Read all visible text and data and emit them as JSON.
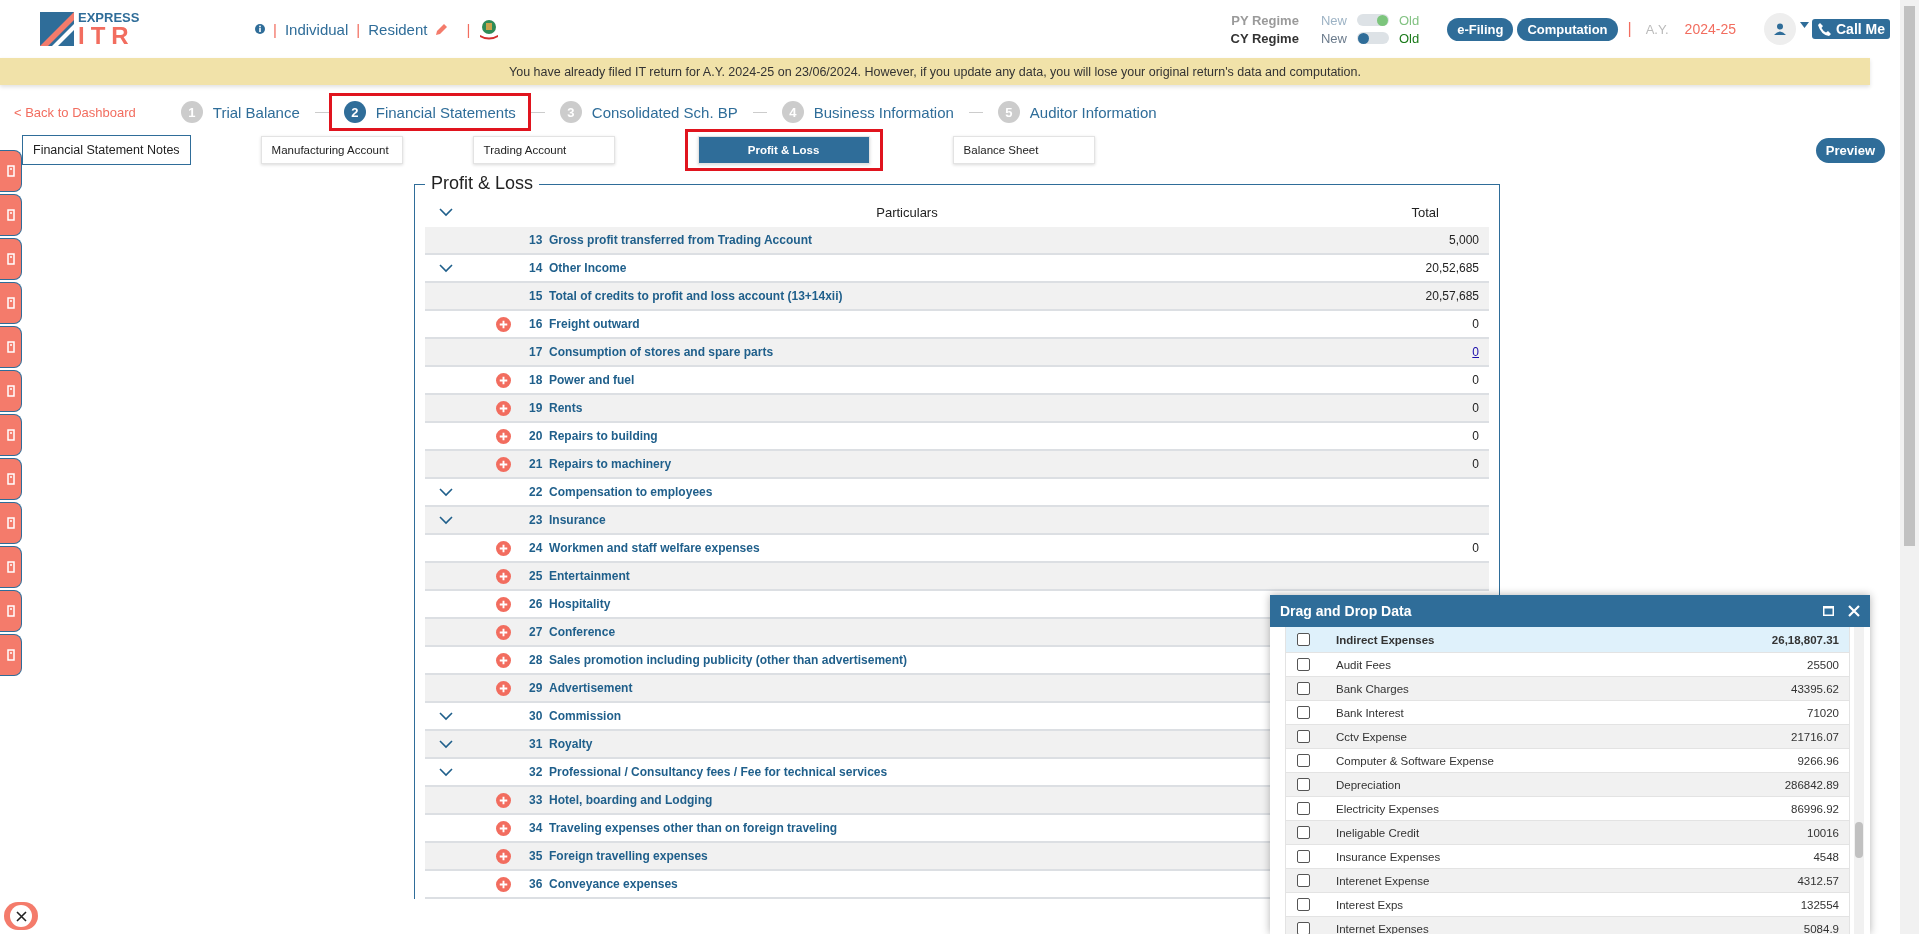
{
  "header": {
    "logo": {
      "top": "EXPRESS",
      "main": "ITR"
    },
    "separator": "|",
    "taxpayer_type": "Individual",
    "residency": "Resident",
    "regimes": [
      {
        "label": "PY Regime",
        "new": "New",
        "old": "Old",
        "old_selected": true,
        "disabled": true
      },
      {
        "label": "CY Regime",
        "new": "New",
        "old": "Old",
        "old_selected": false,
        "disabled": false
      }
    ],
    "buttons": [
      "e-Filing",
      "Computation"
    ],
    "ay_label": "A.Y.",
    "ay_value": "2024-25",
    "call_button": "Call Me"
  },
  "banner": "You have already filed IT return for A.Y. 2024-25 on 23/06/2024. However, if you update any data, you will lose your original return's data and computation.",
  "back_link": "< Back to Dashboard",
  "steps": [
    {
      "number": "1",
      "label": "Trial Balance",
      "selected": false
    },
    {
      "number": "2",
      "label": "Financial Statements",
      "selected": true
    },
    {
      "number": "3",
      "label": "Consolidated Sch. BP",
      "selected": false
    },
    {
      "number": "4",
      "label": "Business Information",
      "selected": false
    },
    {
      "number": "5",
      "label": "Auditor Information",
      "selected": false
    }
  ],
  "notes_button": "Financial Statement Notes",
  "subtabs": [
    {
      "label": "Manufacturing Account",
      "selected": false
    },
    {
      "label": "Trading Account",
      "selected": false
    },
    {
      "label": "Profit & Loss",
      "selected": true
    },
    {
      "label": "Balance Sheet",
      "selected": false
    }
  ],
  "preview_button": "Preview",
  "table": {
    "title": "Profit & Loss",
    "columns": [
      "Particulars",
      "Total"
    ],
    "rows": [
      {
        "kind": "fixed",
        "number": "13",
        "label": "Gross profit transferred from Trading Account",
        "total": "5,000",
        "linked": false
      },
      {
        "kind": "group",
        "number": "14",
        "label": "Other Income",
        "total": "20,52,685",
        "linked": false
      },
      {
        "kind": "fixed",
        "number": "15",
        "label": "Total of credits to profit and loss account (13+14xii)",
        "total": "20,57,685",
        "linked": false
      },
      {
        "kind": "item",
        "number": "16",
        "label": "Freight outward",
        "total": "0",
        "linked": false
      },
      {
        "kind": "fixed",
        "number": "17",
        "label": "Consumption of stores and spare parts",
        "total": "0",
        "linked": true
      },
      {
        "kind": "item",
        "number": "18",
        "label": "Power and fuel",
        "total": "0",
        "linked": false
      },
      {
        "kind": "item",
        "number": "19",
        "label": "Rents",
        "total": "0",
        "linked": false
      },
      {
        "kind": "item",
        "number": "20",
        "label": "Repairs to building",
        "total": "0",
        "linked": false
      },
      {
        "kind": "item",
        "number": "21",
        "label": "Repairs to machinery",
        "total": "0",
        "linked": false
      },
      {
        "kind": "group",
        "number": "22",
        "label": "Compensation to employees"
      },
      {
        "kind": "group",
        "number": "23",
        "label": "Insurance"
      },
      {
        "kind": "item",
        "number": "24",
        "label": "Workmen and staff welfare expenses",
        "total": "0",
        "linked": false
      },
      {
        "kind": "item",
        "number": "25",
        "label": "Entertainment"
      },
      {
        "kind": "item",
        "number": "26",
        "label": "Hospitality"
      },
      {
        "kind": "item",
        "number": "27",
        "label": "Conference"
      },
      {
        "kind": "item",
        "number": "28",
        "label": "Sales promotion including publicity (other than advertisement)"
      },
      {
        "kind": "item",
        "number": "29",
        "label": "Advertisement"
      },
      {
        "kind": "group",
        "number": "30",
        "label": "Commission"
      },
      {
        "kind": "group",
        "number": "31",
        "label": "Royalty"
      },
      {
        "kind": "group",
        "number": "32",
        "label": "Professional / Consultancy fees / Fee for technical services"
      },
      {
        "kind": "item",
        "number": "33",
        "label": "Hotel, boarding and Lodging"
      },
      {
        "kind": "item",
        "number": "34",
        "label": "Traveling expenses other than on foreign traveling"
      },
      {
        "kind": "item",
        "number": "35",
        "label": "Foreign travelling expenses"
      },
      {
        "kind": "item",
        "number": "36",
        "label": "Conveyance expenses"
      }
    ]
  },
  "drag_panel": {
    "title": "Drag and Drop Data",
    "rows": [
      {
        "kind": "group",
        "name": "Indirect Expenses",
        "amount": "26,18,807.31",
        "checked": false
      },
      {
        "kind": "item",
        "name": "Audit Fees",
        "amount": "25500",
        "checked": false
      },
      {
        "kind": "item",
        "name": "Bank Charges",
        "amount": "43395.62",
        "checked": false
      },
      {
        "kind": "item",
        "name": "Bank Interest",
        "amount": "71020",
        "checked": false
      },
      {
        "kind": "item",
        "name": "Cctv Expense",
        "amount": "21716.07",
        "checked": false
      },
      {
        "kind": "item",
        "name": "Computer & Software Expense",
        "amount": "9266.96",
        "checked": false
      },
      {
        "kind": "item",
        "name": "Depreciation",
        "amount": "286842.89",
        "checked": false
      },
      {
        "kind": "item",
        "name": "Electricity Expenses",
        "amount": "86996.92",
        "checked": false
      },
      {
        "kind": "item",
        "name": "Ineligable Credit",
        "amount": "10016",
        "checked": false
      },
      {
        "kind": "item",
        "name": "Insurance Expenses",
        "amount": "4548",
        "checked": false
      },
      {
        "kind": "item",
        "name": "Interenet Expense",
        "amount": "4312.57",
        "checked": false
      },
      {
        "kind": "item",
        "name": "Interest Exps",
        "amount": "132554",
        "checked": false
      },
      {
        "kind": "item",
        "name": "Internet Expenses",
        "amount": "5084.9",
        "checked": false
      }
    ]
  }
}
